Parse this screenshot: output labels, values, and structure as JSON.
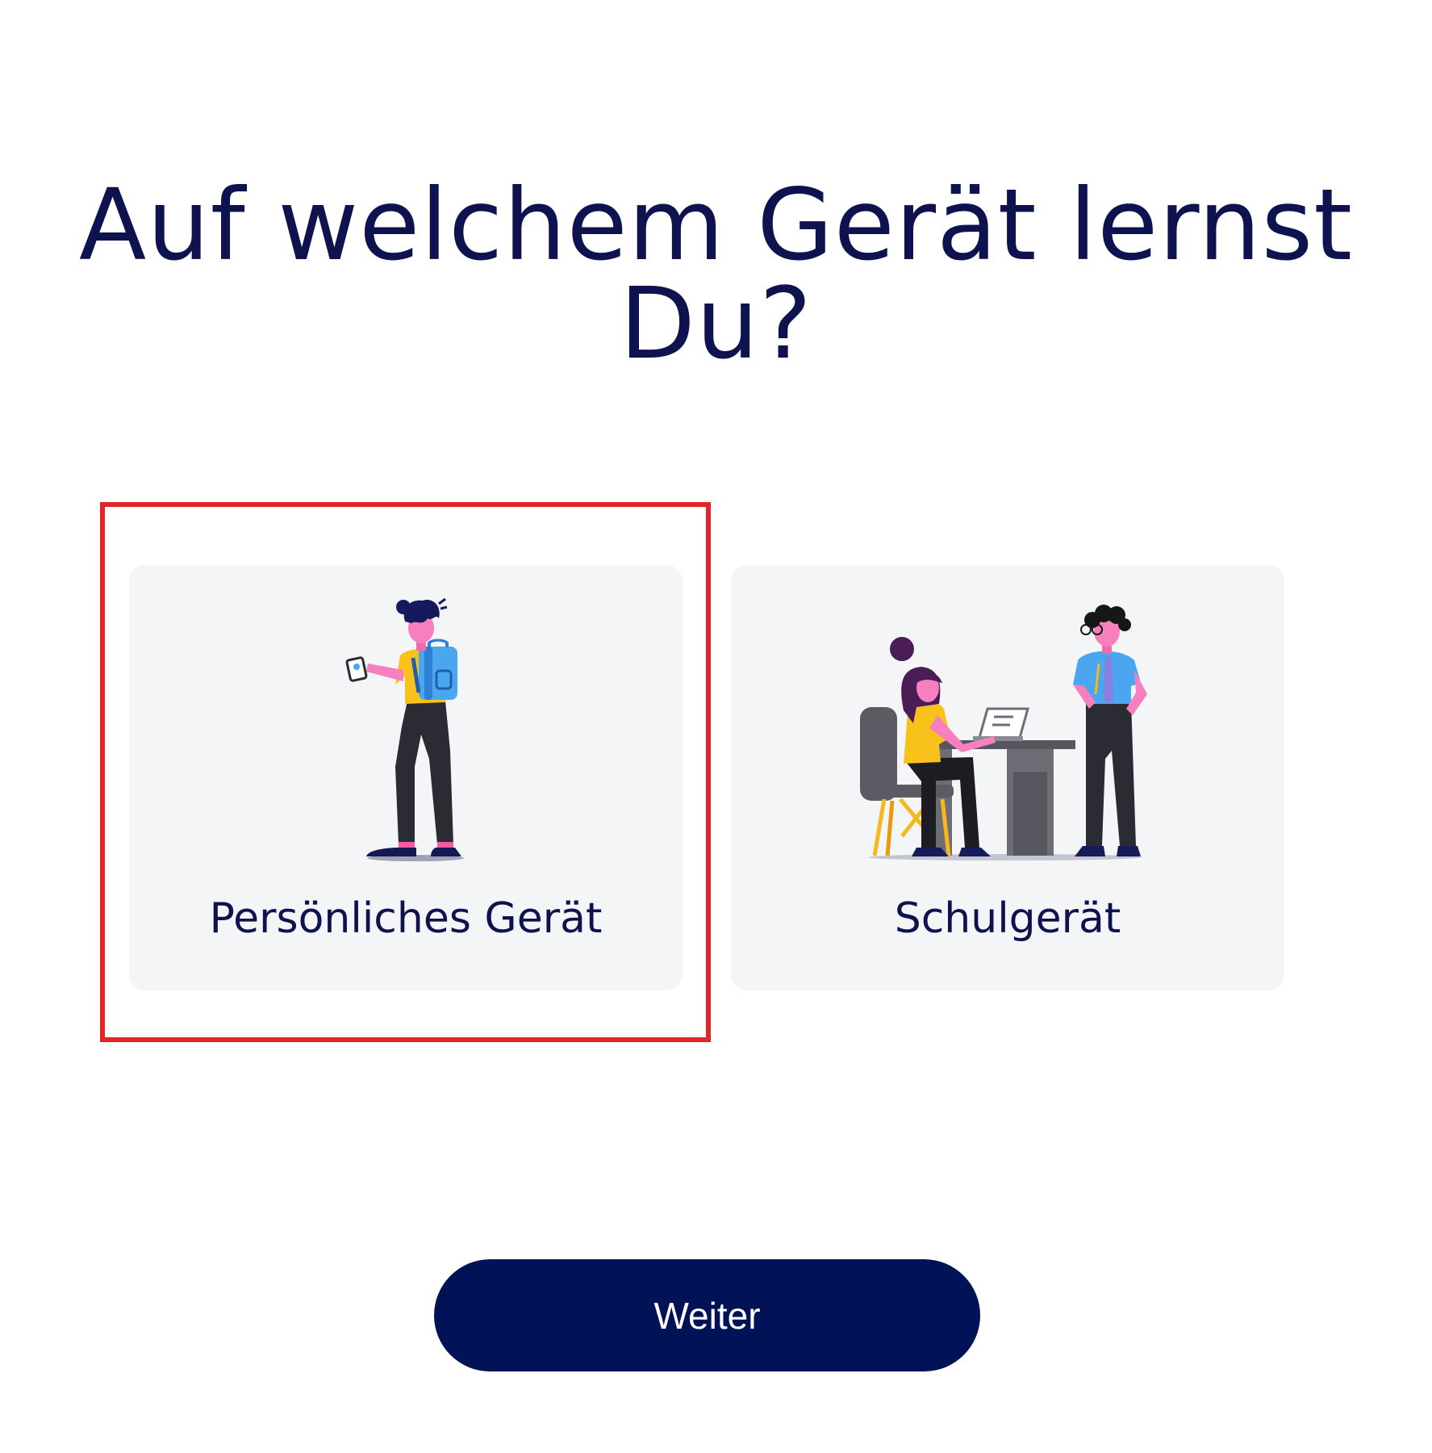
{
  "page": {
    "title": "Auf welchem Gerät lernst Du?"
  },
  "options": [
    {
      "label": "Persönliches Gerät",
      "illustration": "student-with-backpack-and-phone-illustration",
      "selected": true
    },
    {
      "label": "Schulgerät",
      "illustration": "classroom-desk-laptop-illustration",
      "selected": false
    }
  ],
  "actions": {
    "continue_label": "Weiter"
  },
  "colors": {
    "title": "#0e1350",
    "selection_border": "#e4242b",
    "card_background": "#f4f5f7",
    "button_background": "#011257",
    "button_text": "#ffffff"
  }
}
